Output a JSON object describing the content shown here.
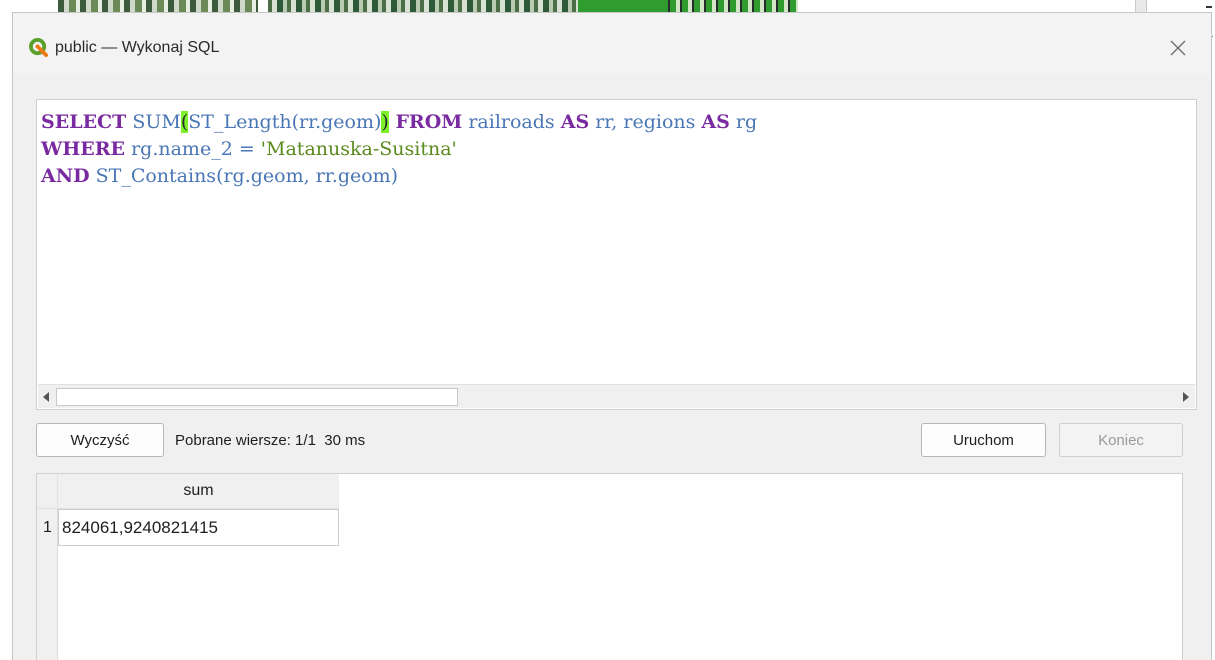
{
  "window": {
    "title": "public — Wykonaj SQL"
  },
  "editor": {
    "line1": {
      "kw_select": "SELECT",
      "fn_sum": " SUM",
      "paren_open": "(",
      "inner": "ST_Length(rr.geom)",
      "paren_close": ")",
      "kw_from": " FROM",
      "t1": " railroads ",
      "kw_as1": "AS",
      "t2": " rr, regions ",
      "kw_as2": "AS",
      "t3": " rg"
    },
    "line2": {
      "kw_where": "WHERE",
      "cond": " rg.name_2 = ",
      "str": "'Matanuska-Susitna'"
    },
    "line3": {
      "kw_and": "AND",
      "rest": " ST_Contains(rg.geom, rr.geom)"
    }
  },
  "toolbar": {
    "clear_label": "Wyczyść",
    "status": "Pobrane wiersze: 1/1  30 ms",
    "run_label": "Uruchom",
    "stop_label": "Koniec"
  },
  "results": {
    "columns": [
      "sum"
    ],
    "rows": [
      {
        "index": "1",
        "values": [
          "824061,9240821415"
        ]
      }
    ]
  },
  "colors": {
    "keyword": "#7a2aa0",
    "identifier": "#4a76b5",
    "string": "#5a8a1e",
    "bracket_highlight": "#7cf22a"
  },
  "icons": {
    "app": "qgis-logo-icon",
    "close": "close-icon"
  }
}
